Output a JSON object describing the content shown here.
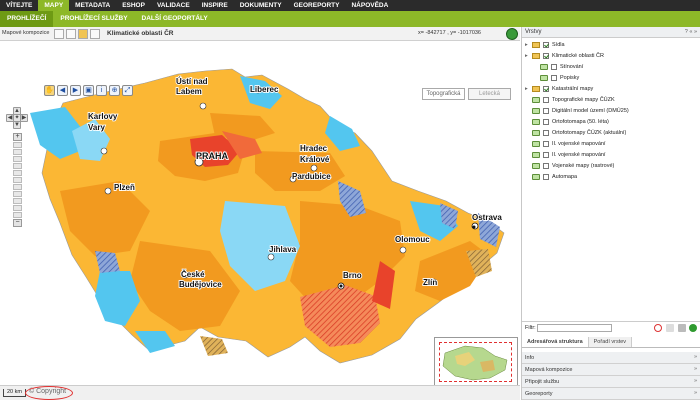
{
  "top_nav": [
    "VÍTEJTE",
    "MAPY",
    "METADATA",
    "ESHOP",
    "VALIDACE",
    "INSPIRE",
    "DOKUMENTY",
    "GEOREPORTY",
    "NÁPOVĚDA"
  ],
  "top_nav_active": "MAPY",
  "sub_nav": [
    "PROHLÍŽEČÍ",
    "PROHLÍŽECÍ SLUŽBY",
    "DALŠÍ GEOPORTÁLY"
  ],
  "map_toolbar": {
    "composition_label": "Mapové kompozice",
    "map_title": "Klimatické oblasti ČR",
    "coords": "x= -842717 , y= -1017036"
  },
  "base_layers": {
    "topo": "Topografická",
    "aerial": "Letecká"
  },
  "cities": {
    "usti": "Ústí nad Labem",
    "liberec": "Liberec",
    "karlovy_vary": "Karlovy Vary",
    "praha": "PRAHA",
    "hradec": "Hradec Králové",
    "pardubice": "Pardubice",
    "plzen": "Plzeň",
    "jihlava": "Jihlava",
    "olomouc": "Olomouc",
    "ostrava": "Ostrava",
    "budejovice": "České Budějovice",
    "brno": "Brno",
    "zlin": "Zlín"
  },
  "status": {
    "scale": "20 km",
    "copyright": "© Copyright"
  },
  "sidebar": {
    "title": "Vrstvy",
    "controls": "? « »",
    "layers": [
      {
        "label": "Sídla",
        "checked": true,
        "type": "folder",
        "indent": 0
      },
      {
        "label": "Klimatické oblasti ČR",
        "checked": true,
        "type": "folder",
        "indent": 0
      },
      {
        "label": "Stínování",
        "checked": false,
        "type": "wms",
        "indent": 1
      },
      {
        "label": "Popisky",
        "checked": false,
        "type": "wms",
        "indent": 1
      },
      {
        "label": "Katastrální mapy",
        "checked": true,
        "type": "folder",
        "indent": 0
      },
      {
        "label": "Topografické mapy ČÚZK",
        "checked": false,
        "type": "wms",
        "indent": 0
      },
      {
        "label": "Digitální model území (DMÚ25)",
        "checked": false,
        "type": "wms",
        "indent": 0
      },
      {
        "label": "Ortofotomapa (50. léta)",
        "checked": false,
        "type": "wms",
        "indent": 0
      },
      {
        "label": "Ortofotomapy ČÚZK (aktuální)",
        "checked": false,
        "type": "wms",
        "indent": 0
      },
      {
        "label": "II. vojenské mapování",
        "checked": false,
        "type": "wms",
        "indent": 0
      },
      {
        "label": "II. vojenské mapování",
        "checked": false,
        "type": "wms",
        "indent": 0
      },
      {
        "label": "Vojenské mapy (rastrové)",
        "checked": false,
        "type": "wms",
        "indent": 0
      },
      {
        "label": "Automapa",
        "checked": false,
        "type": "wms",
        "indent": 0
      }
    ],
    "filter_label": "Filtr:",
    "tabs": [
      "Adresářová struktura",
      "Pořadí vrstev"
    ],
    "panels": [
      "Info",
      "Mapová kompozice",
      "Připojit službu",
      "Georeporty"
    ]
  },
  "colors": {
    "accent": "#8db828",
    "dark_nav": "#2b2b2b",
    "warm": "#f29a1f",
    "cool": "#53c6ef",
    "callout": "#e03030"
  }
}
